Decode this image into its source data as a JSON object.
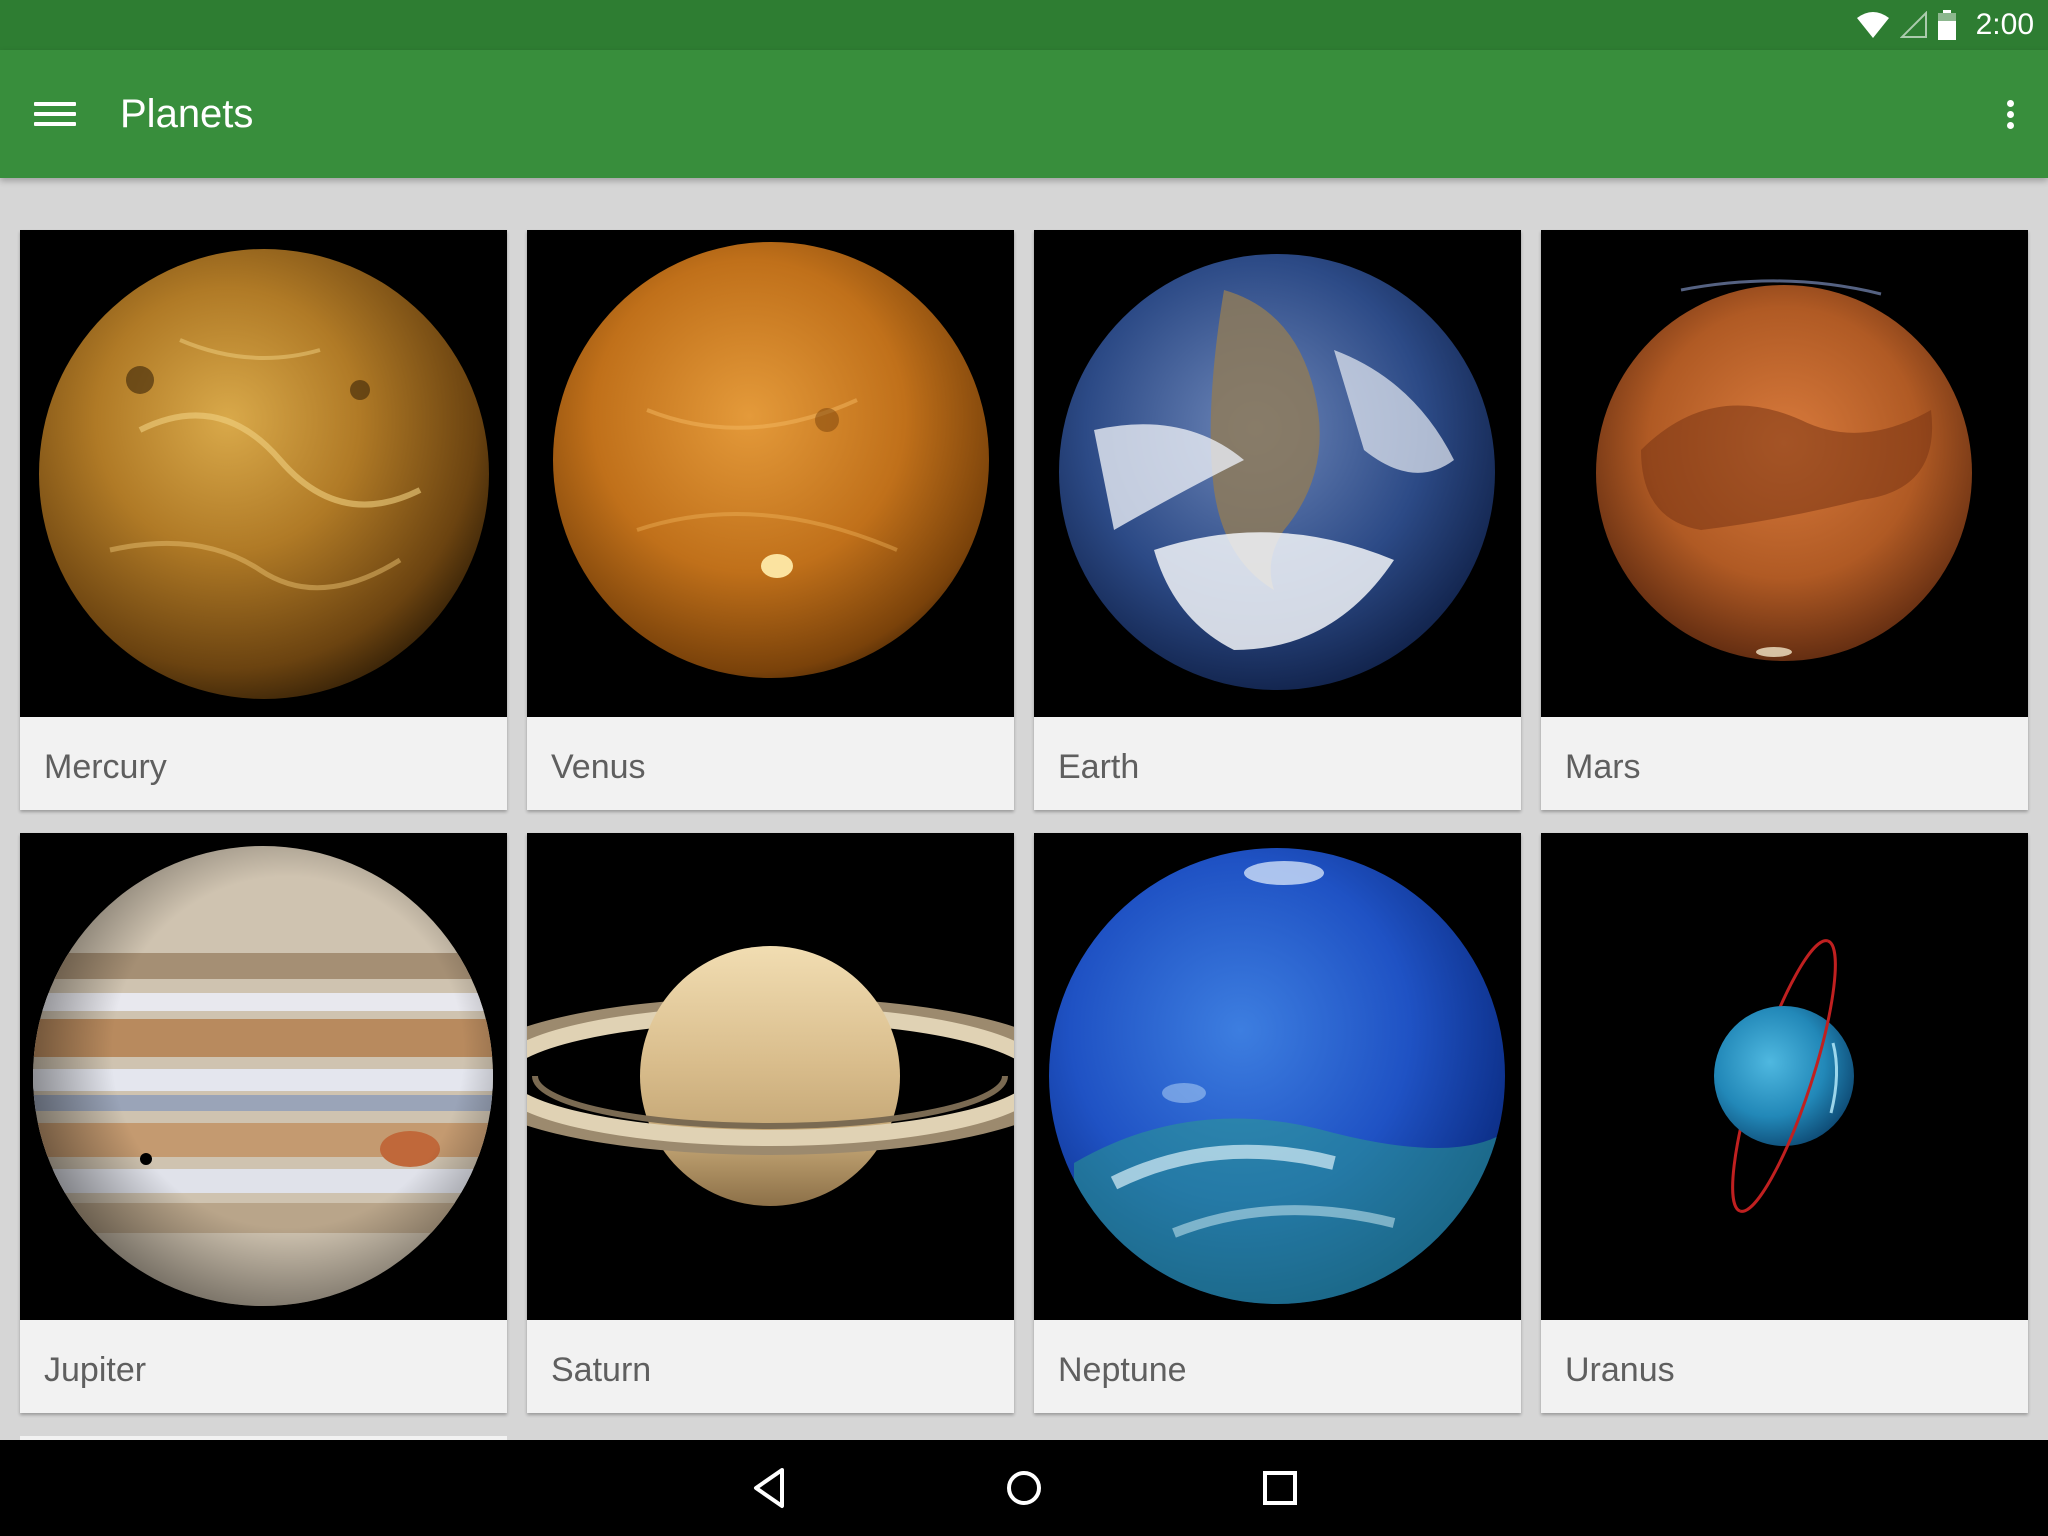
{
  "status_bar": {
    "time": "2:00",
    "icons": [
      "wifi-icon",
      "cell-signal-icon",
      "battery-icon"
    ]
  },
  "app_bar": {
    "title": "Planets",
    "nav_icon": "menu-icon",
    "action_icon": "more-vert-icon",
    "color": "#388e3c",
    "status_color": "#2e7d32"
  },
  "planets": [
    {
      "name": "Mercury"
    },
    {
      "name": "Venus"
    },
    {
      "name": "Earth"
    },
    {
      "name": "Mars"
    },
    {
      "name": "Jupiter"
    },
    {
      "name": "Saturn"
    },
    {
      "name": "Neptune"
    },
    {
      "name": "Uranus"
    }
  ],
  "nav_bar": {
    "buttons": [
      "back-icon",
      "home-icon",
      "recents-icon"
    ]
  }
}
